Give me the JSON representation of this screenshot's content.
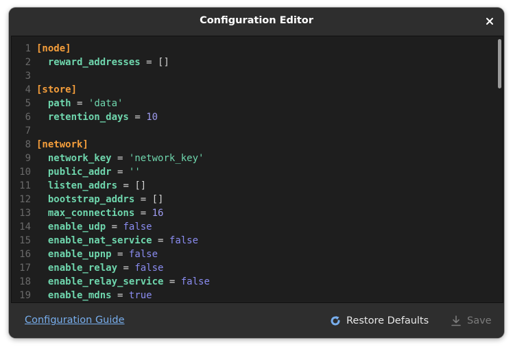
{
  "dialog": {
    "title": "Configuration Editor",
    "close_icon": "close-icon"
  },
  "editor": {
    "lines": [
      {
        "n": "1",
        "type": "section",
        "text": "[node]"
      },
      {
        "n": "2",
        "type": "kv",
        "key": "reward_addresses",
        "value": "[]",
        "vtype": "arr"
      },
      {
        "n": "3",
        "type": "blank"
      },
      {
        "n": "4",
        "type": "section",
        "text": "[store]"
      },
      {
        "n": "5",
        "type": "kv",
        "key": "path",
        "value": "'data'",
        "vtype": "str"
      },
      {
        "n": "6",
        "type": "kv",
        "key": "retention_days",
        "value": "10",
        "vtype": "num"
      },
      {
        "n": "7",
        "type": "blank"
      },
      {
        "n": "8",
        "type": "section",
        "text": "[network]"
      },
      {
        "n": "9",
        "type": "kv",
        "key": "network_key",
        "value": "'network_key'",
        "vtype": "str"
      },
      {
        "n": "10",
        "type": "kv",
        "key": "public_addr",
        "value": "''",
        "vtype": "str"
      },
      {
        "n": "11",
        "type": "kv",
        "key": "listen_addrs",
        "value": "[]",
        "vtype": "arr"
      },
      {
        "n": "12",
        "type": "kv",
        "key": "bootstrap_addrs",
        "value": "[]",
        "vtype": "arr"
      },
      {
        "n": "13",
        "type": "kv",
        "key": "max_connections",
        "value": "16",
        "vtype": "num"
      },
      {
        "n": "14",
        "type": "kv",
        "key": "enable_udp",
        "value": "false",
        "vtype": "bool"
      },
      {
        "n": "15",
        "type": "kv",
        "key": "enable_nat_service",
        "value": "false",
        "vtype": "bool"
      },
      {
        "n": "16",
        "type": "kv",
        "key": "enable_upnp",
        "value": "false",
        "vtype": "bool"
      },
      {
        "n": "17",
        "type": "kv",
        "key": "enable_relay",
        "value": "false",
        "vtype": "bool"
      },
      {
        "n": "18",
        "type": "kv",
        "key": "enable_relay_service",
        "value": "false",
        "vtype": "bool"
      },
      {
        "n": "19",
        "type": "kv",
        "key": "enable_mdns",
        "value": "true",
        "vtype": "bool"
      }
    ],
    "operator": "="
  },
  "footer": {
    "guide_link": "Configuration Guide",
    "restore_label": "Restore Defaults",
    "restore_icon": "refresh-icon",
    "save_label": "Save",
    "save_icon": "download-icon"
  },
  "colors": {
    "section": "#f59e3b",
    "key": "#6fd6ad",
    "number": "#9f9cf0",
    "boolean": "#8a8cf0",
    "link": "#78aeed"
  }
}
